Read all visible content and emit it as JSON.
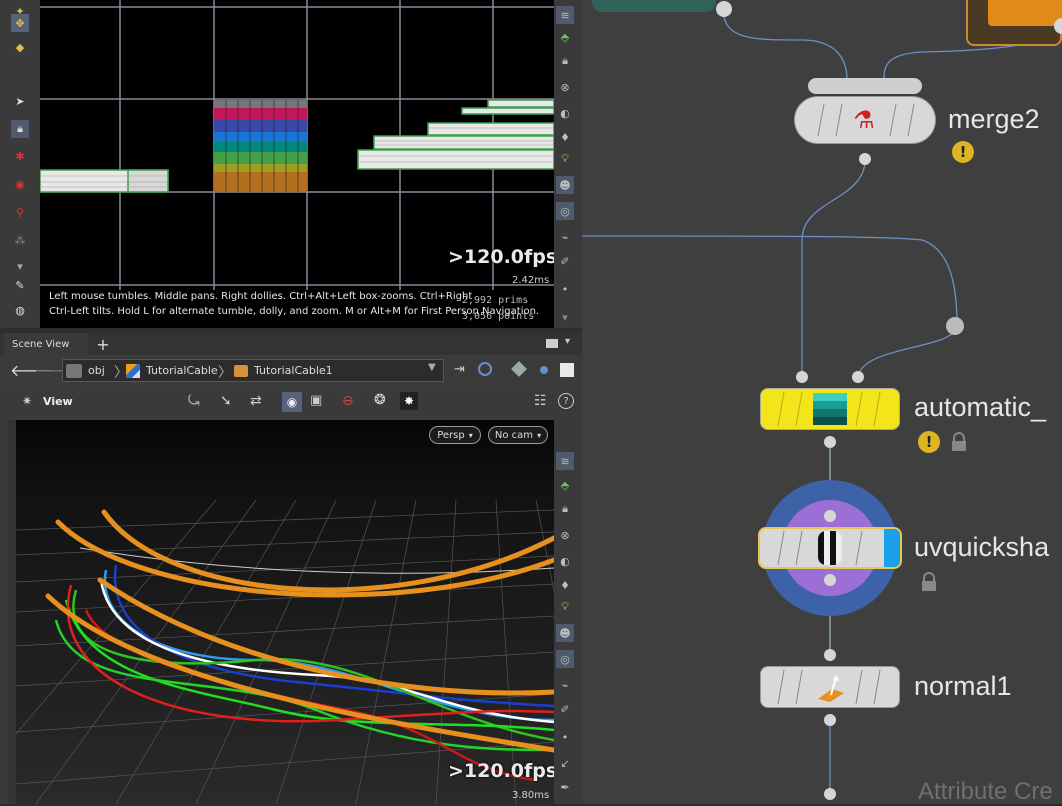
{
  "top_viewport": {
    "fps": ">120.0fps",
    "ms": "2.42ms",
    "help_line1": "Left mouse tumbles. Middle pans. Right dollies. Ctrl+Alt+Left box-zooms. Ctrl+Right",
    "help_line2": "Ctrl-Left tilts. Hold L for alternate tumble, dolly, and zoom.     M or Alt+M for First Person Navigation.",
    "prims": "2,992  prims",
    "points": "3,056  points"
  },
  "tabs": {
    "scene_view": "Scene View",
    "add": "+"
  },
  "path": {
    "obj": "obj",
    "geo1": "TutorialCable",
    "geo2": "TutorialCable1"
  },
  "view_toolbar": {
    "view_label": "View"
  },
  "bottom_viewport": {
    "persp": "Persp",
    "camera": "No cam",
    "fps": ">120.0fps",
    "ms": "3.80ms"
  },
  "network": {
    "nodes": [
      {
        "name": "merge2",
        "warning": true,
        "locked": false
      },
      {
        "name": "automatic_",
        "warning": true,
        "locked": true
      },
      {
        "name": "uvquicksha",
        "warning": false,
        "locked": true
      },
      {
        "name": "normal1",
        "warning": false,
        "locked": false
      }
    ],
    "footer_hint": "Attribute Cre"
  },
  "colors": {
    "automatic_node": "#f2e51a",
    "uvquickshade_ring_outer": "#3d62a8",
    "uvquickshade_ring_inner": "#9b6fd6",
    "uvquickshade_stripe": "#1a9fe8",
    "cable_orange": "#e8901e"
  },
  "icons": [
    "select-icon",
    "lock-icon",
    "rotate-icon",
    "snap-icon",
    "pin-icon",
    "dots-icon",
    "handle-icon",
    "brush-icon",
    "view-icon",
    "camera-icon",
    "light-icon",
    "ghost-icon",
    "eye-icon",
    "help-icon",
    "warning-icon"
  ]
}
